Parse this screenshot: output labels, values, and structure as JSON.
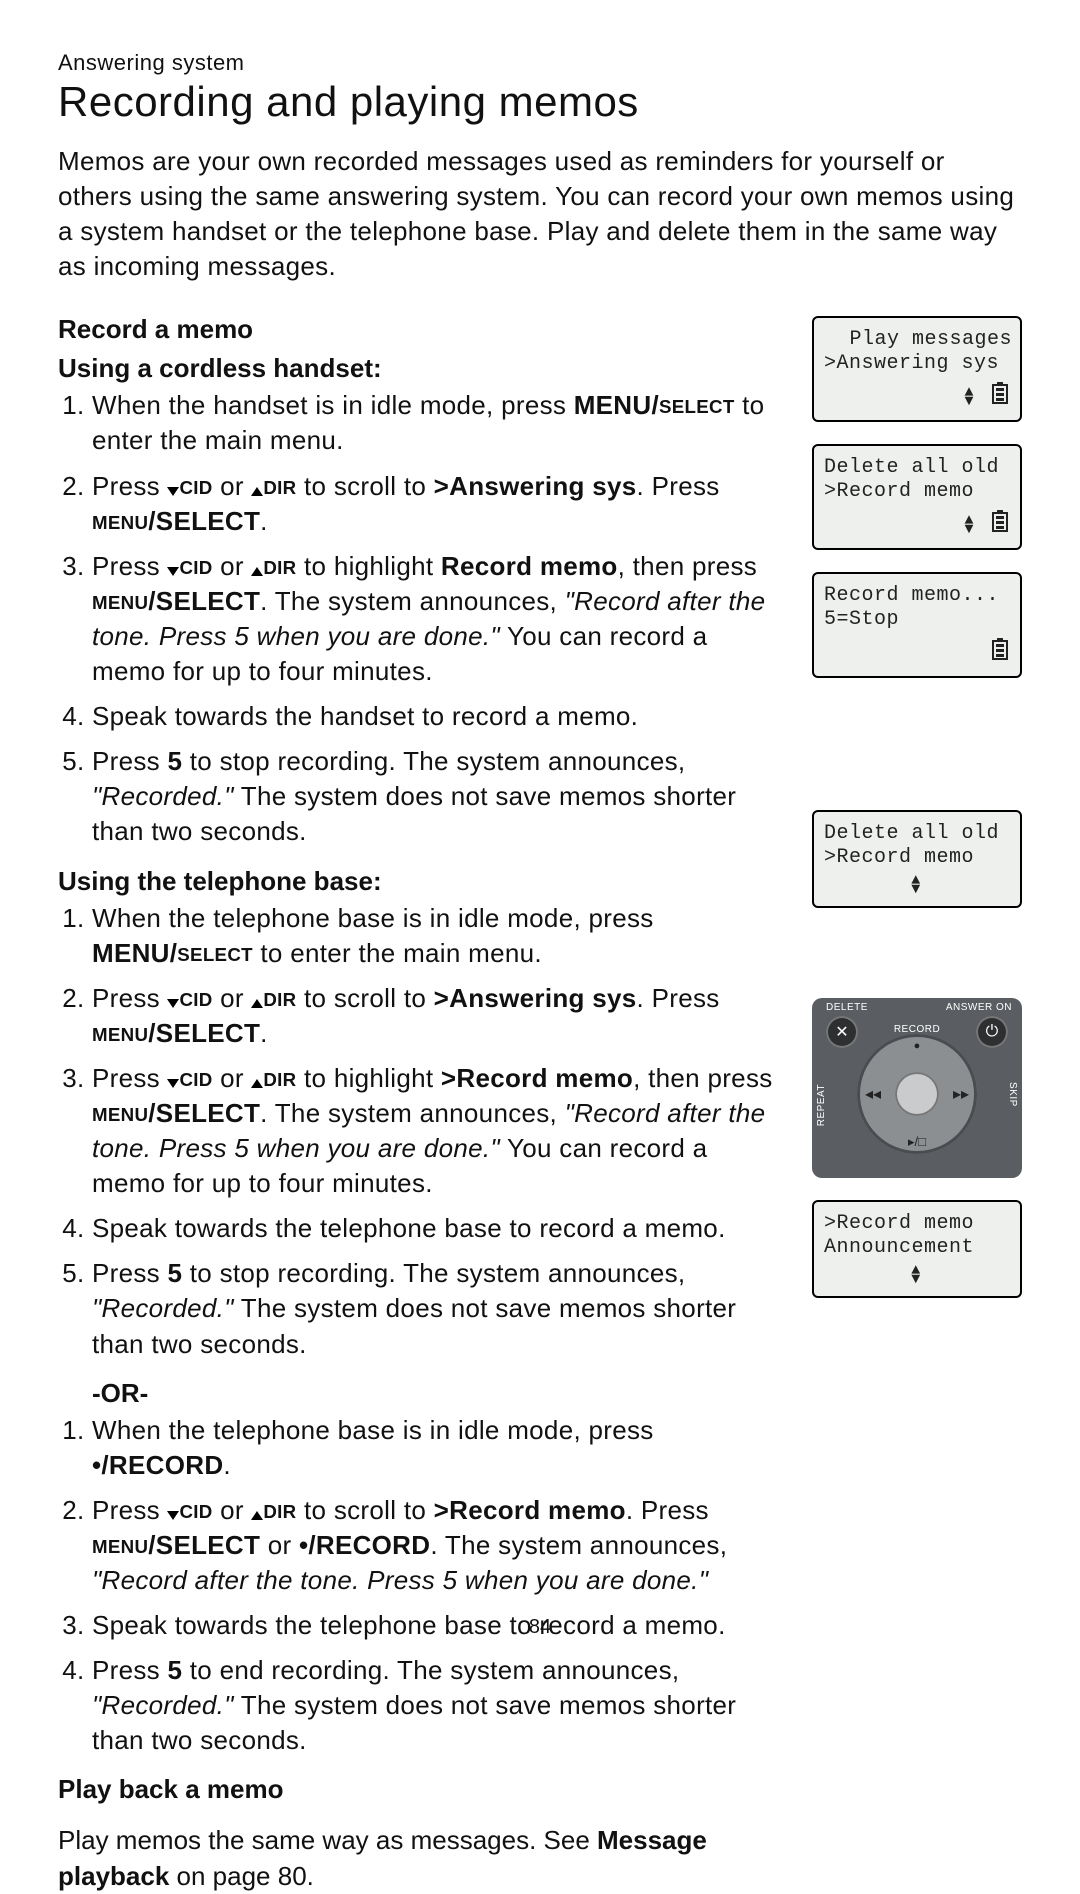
{
  "page": {
    "section_label": "Answering system",
    "title": "Recording and playing memos",
    "intro": "Memos are your own recorded messages used as reminders for yourself or others using the same answering system. You can record your own memos using a system handset or the telephone base. Play and delete them in the same way as incoming messages.",
    "page_number": "84"
  },
  "headings": {
    "record": "Record a memo",
    "handset": "Using a cordless handset:",
    "base": "Using the telephone base:",
    "or": "-OR-",
    "playback": "Play back a memo"
  },
  "labels": {
    "menu_select": "MENU/SELECT",
    "menu_select_sc": "MENU/SELECT",
    "cid": "CID",
    "dir": "DIR",
    "answering_sys": ">Answering sys",
    "record_memo_bold": "Record memo",
    "record_memo_angle": ">Record memo",
    "record_btn": "•/RECORD",
    "five": "5",
    "msg_playback": "Message playback"
  },
  "quotes": {
    "record_after": "\"Record after the tone. Press 5 when you are done.\"",
    "recorded": "\"Recorded.\""
  },
  "handset_tail": {
    "s1b": "enter the main menu.",
    "s3b": "You can record a memo for up to four minutes.",
    "s4": "Speak towards the handset to record a memo.",
    "s5b": "The system does not save memos shorter than two seconds."
  },
  "base_tail": {
    "s1": "When the telephone base is in idle mode, press",
    "s1b": "to enter the main menu.",
    "s3b": "You can record a memo for up to four minutes.",
    "s4": "Speak towards the telephone base to record a memo.",
    "s5b": "The system does not save memos shorter than two seconds."
  },
  "alt_tail": {
    "s1": "When the telephone base is in idle mode, press",
    "s3": "Speak towards the telephone base to record a memo.",
    "s4b": "The system does not save memos shorter than two seconds."
  },
  "playback_note_a": "Play memos the same way as messages. See ",
  "playback_note_b": " on page 80.",
  "lcd": {
    "a": {
      "l1": "Play messages",
      "l2": ">Answering sys"
    },
    "b": {
      "l1": "Delete all old",
      "l2": ">Record memo"
    },
    "c": {
      "l1": "Record memo...",
      "l2": "5=Stop"
    },
    "d": {
      "l1": "Delete all old",
      "l2": ">Record memo"
    },
    "e": {
      "l1": ">Record memo",
      "l2": " Announcement"
    }
  },
  "pad": {
    "delete": "DELETE",
    "answer_on": "ANSWER ON",
    "record": "RECORD",
    "repeat": "REPEAT",
    "skip": "SKIP",
    "x": "✕",
    "power": "⏻",
    "rew": "◂◂",
    "ffwd": "▸▸",
    "rec_dot": "●",
    "playstop": "▸/□"
  }
}
